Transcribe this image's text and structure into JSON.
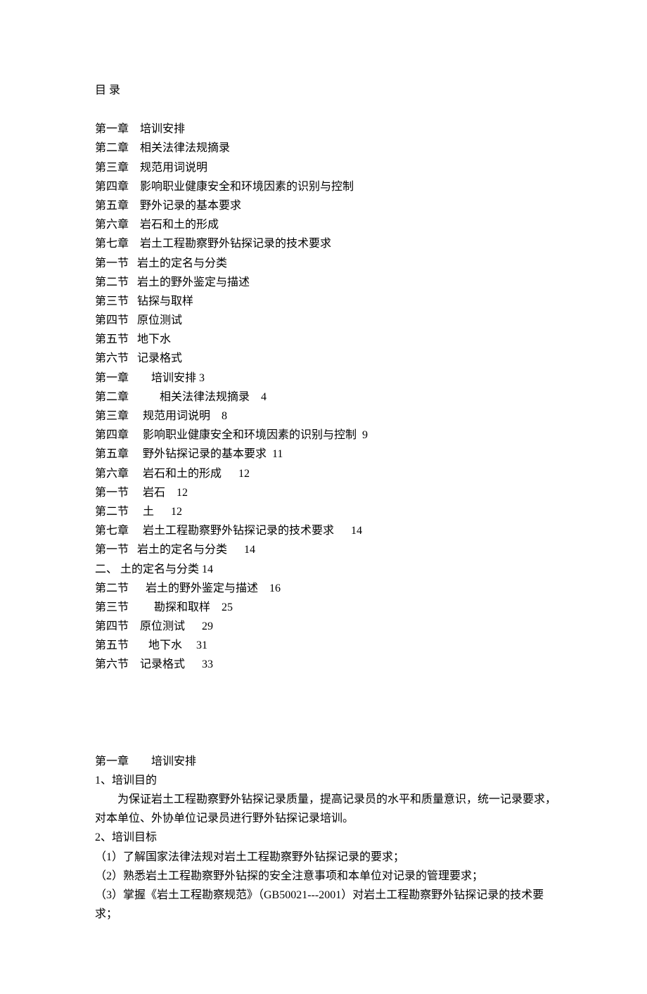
{
  "toc": {
    "title": "目            录",
    "items_part1": [
      "第一章    培训安排",
      "第二章    相关法律法规摘录",
      "第三章    规范用词说明",
      "第四章    影响职业健康安全和环境因素的识别与控制",
      "第五章    野外记录的基本要求",
      "第六章    岩石和土的形成",
      "第七章    岩土工程勘察野外钻探记录的技术要求",
      "第一节   岩土的定名与分类",
      "第二节   岩土的野外鉴定与描述",
      "第三节   钻探与取样",
      "第四节   原位测试",
      "第五节   地下水",
      "第六节   记录格式"
    ],
    "items_part2": [
      "第一章        培训安排 3",
      "第二章           相关法律法规摘录    4",
      "第三章     规范用词说明    8",
      "第四章     影响职业健康安全和环境因素的识别与控制  9",
      "第五章     野外钻探记录的基本要求  11",
      "第六章     岩石和土的形成      12",
      "第一节     岩石    12",
      "第二节     土      12",
      "第七章     岩土工程勘察野外钻探记录的技术要求      14",
      "第一节   岩土的定名与分类      14",
      "二、 土的定名与分类 14",
      "第二节      岩土的野外鉴定与描述    16",
      "第三节         勘探和取样    25",
      "第四节    原位测试      29",
      "第五节       地下水     31",
      "第六节    记录格式      33"
    ]
  },
  "chapter1": {
    "heading": "第一章        培训安排",
    "sec1_title": "1、培训目的",
    "sec1_body": "为保证岩土工程勘察野外钻探记录质量，提高记录员的水平和质量意识，统一记录要求，对本单位、外协单位记录员进行野外钻探记录培训。",
    "sec2_title": "2、培训目标",
    "sec2_items": [
      "（1）了解国家法律法规对岩土工程勘察野外钻探记录的要求；",
      "（2）熟悉岩土工程勘察野外钻探的安全注意事项和本单位对记录的管理要求；",
      "（3）掌握《岩土工程勘察规范》（GB50021---2001）对岩土工程勘察野外钻探记录的技术要求；"
    ]
  }
}
